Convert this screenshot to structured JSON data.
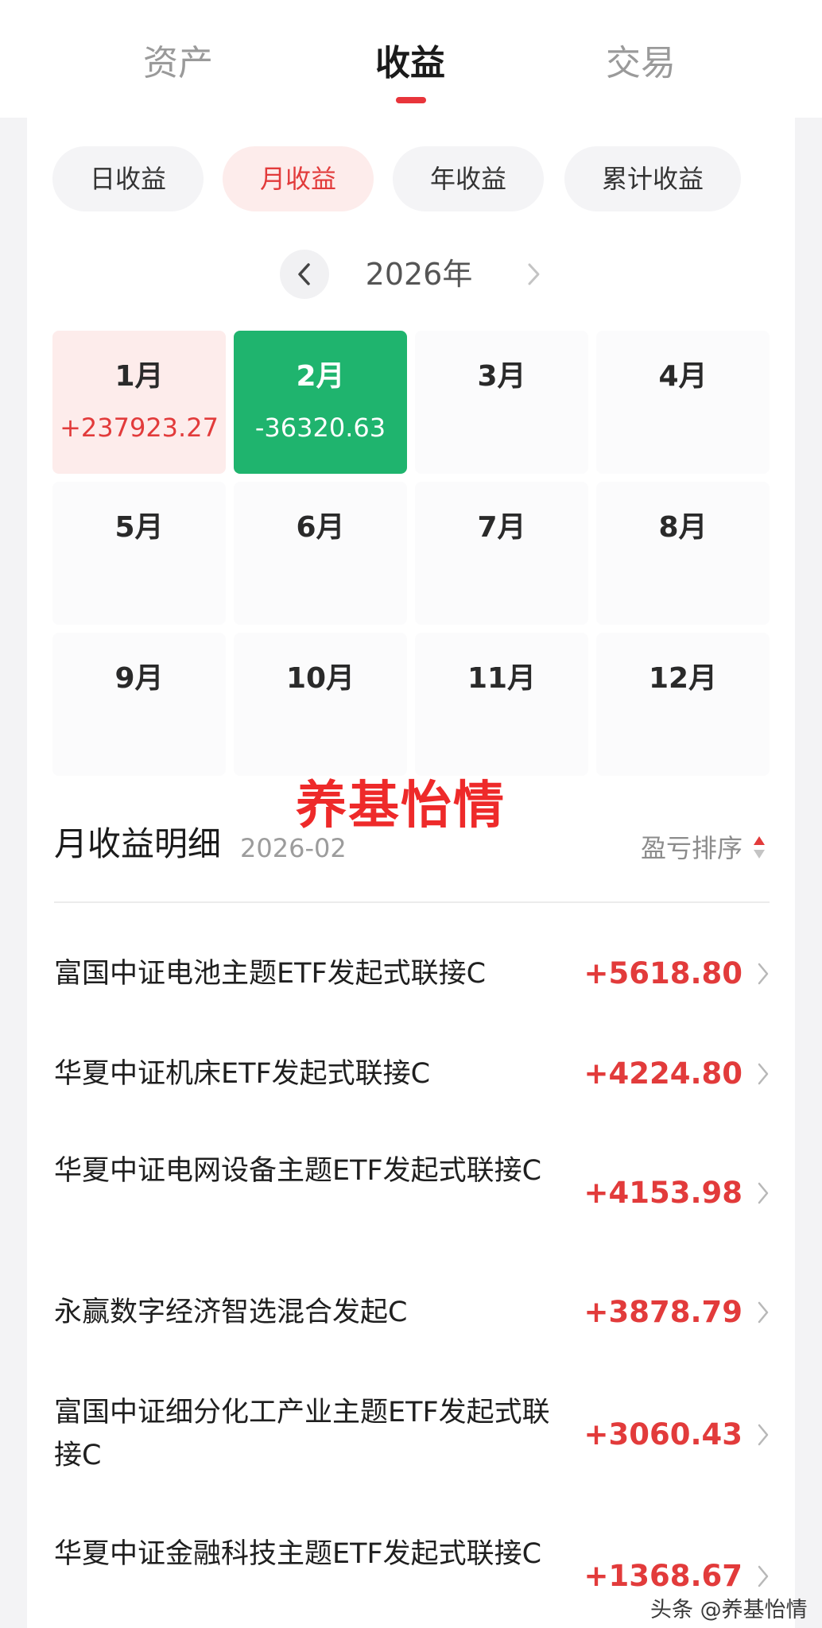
{
  "top_tabs": [
    {
      "label": "资产",
      "active": false
    },
    {
      "label": "收益",
      "active": true
    },
    {
      "label": "交易",
      "active": false
    }
  ],
  "segments": [
    {
      "label": "日收益",
      "active": false
    },
    {
      "label": "月收益",
      "active": true
    },
    {
      "label": "年收益",
      "active": false
    },
    {
      "label": "累计收益",
      "active": false
    }
  ],
  "year": "2026年",
  "months": [
    {
      "label": "1月",
      "value": "+237923.27",
      "state": "positive"
    },
    {
      "label": "2月",
      "value": "-36320.63",
      "state": "negative"
    },
    {
      "label": "3月",
      "value": "",
      "state": "empty"
    },
    {
      "label": "4月",
      "value": "",
      "state": "empty"
    },
    {
      "label": "5月",
      "value": "",
      "state": "empty"
    },
    {
      "label": "6月",
      "value": "",
      "state": "empty"
    },
    {
      "label": "7月",
      "value": "",
      "state": "empty"
    },
    {
      "label": "8月",
      "value": "",
      "state": "empty"
    },
    {
      "label": "9月",
      "value": "",
      "state": "empty"
    },
    {
      "label": "10月",
      "value": "",
      "state": "empty"
    },
    {
      "label": "11月",
      "value": "",
      "state": "empty"
    },
    {
      "label": "12月",
      "value": "",
      "state": "empty"
    }
  ],
  "watermark": "养基怡情",
  "detail": {
    "title": "月收益明细",
    "date": "2026-02",
    "sort_label": "盈亏排序"
  },
  "funds": [
    {
      "name": "富国中证电池主题ETF发起式联接C",
      "value": "+5618.80"
    },
    {
      "name": "华夏中证机床ETF发起式联接C",
      "value": "+4224.80"
    },
    {
      "name": "华夏中证电网设备主题ETF发起式联接C",
      "value": "+4153.98"
    },
    {
      "name": "永赢数字经济智选混合发起C",
      "value": "+3878.79"
    },
    {
      "name": "富国中证细分化工产业主题ETF发起式联接C",
      "value": "+3060.43"
    },
    {
      "name": "华夏中证金融科技主题ETF发起式联接C",
      "value": "+1368.67"
    }
  ],
  "footer_watermark": "头条 @养基怡情",
  "colors": {
    "accent_red": "#e23b3b",
    "positive_bg": "#fdeceb",
    "negative_bg": "#1fb46e"
  }
}
